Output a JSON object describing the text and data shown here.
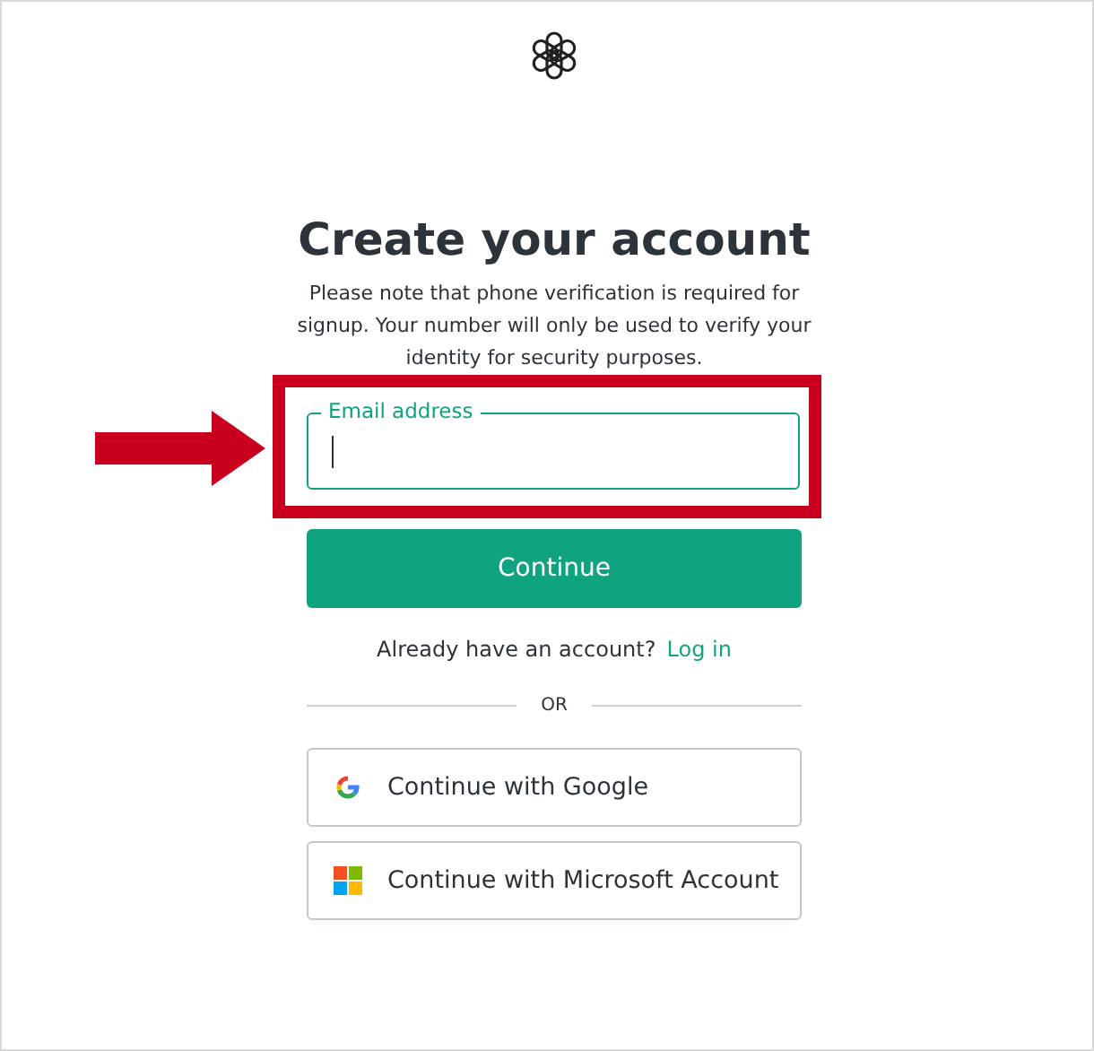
{
  "title": "Create your account",
  "notice": "Please note that phone verification is required for signup. Your number will only be used to verify your identity for security purposes.",
  "email_field": {
    "label": "Email address",
    "focused": true,
    "highlighted": true
  },
  "continue_button": "Continue",
  "login_prompt": {
    "text": "Already have an account?",
    "link": "Log in"
  },
  "divider_text": "OR",
  "social_buttons": [
    {
      "kind": "google",
      "label": "Continue with Google"
    },
    {
      "kind": "microsoft",
      "label": "Continue with Microsoft Account"
    }
  ]
}
